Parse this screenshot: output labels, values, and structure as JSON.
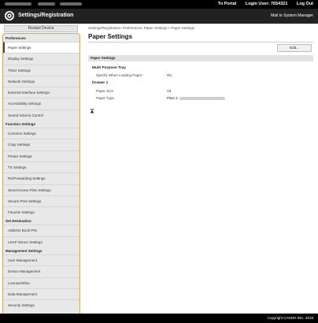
{
  "topbar": {
    "portal_label": "To Portal",
    "login_label": "Login User:",
    "login_user": "7654321",
    "logout_label": "Log Out"
  },
  "titlebar": {
    "app_title": "Settings/Registration",
    "mail_label": "Mail to System Manager",
    "logo_icon": "settings-gear-icon"
  },
  "sidebar": {
    "restart_label": "Restart Device",
    "sections": [
      {
        "title": "Preferences",
        "items": [
          "Paper Settings",
          "Display Settings",
          "Timer Settings",
          "Network Settings",
          "External Interface Settings",
          "Accessibility Settings",
          "Sound Volume Control"
        ]
      },
      {
        "title": "Function Settings",
        "items": [
          "Common Settings",
          "Copy Settings",
          "Printer Settings",
          "TX Settings",
          "RX/Forwarding Settings",
          "Store/Access Files Settings",
          "Secure Print Settings",
          "Favorite Settings"
        ]
      },
      {
        "title": "Set Destination",
        "items": [
          "Address Book PIN",
          "LDAP Server Settings"
        ]
      },
      {
        "title": "Management Settings",
        "items": [
          "User Management",
          "Device Management",
          "License/Other",
          "Data Management",
          "Security Settings"
        ]
      }
    ],
    "active_item": "Paper Settings"
  },
  "main": {
    "breadcrumb": "Settings/Registration: Preferences: Paper Settings > Paper Settings",
    "title": "Paper Settings",
    "edit_label": "Edit...",
    "section_title": "Paper Settings",
    "multi_purpose_tray": {
      "title": "Multi Purpose Tray",
      "specify_label": "Specify When Loading Paper:",
      "specify_value": "On"
    },
    "drawer1": {
      "title": "Drawer 1",
      "size_label": "Paper Size",
      "size_value": "A4",
      "type_label": "Paper Type",
      "type_value": "Plain 2"
    },
    "to_top_icon": "to-top-icon"
  },
  "footer": {
    "copyright": "Copyright CANON INC. 2018"
  }
}
